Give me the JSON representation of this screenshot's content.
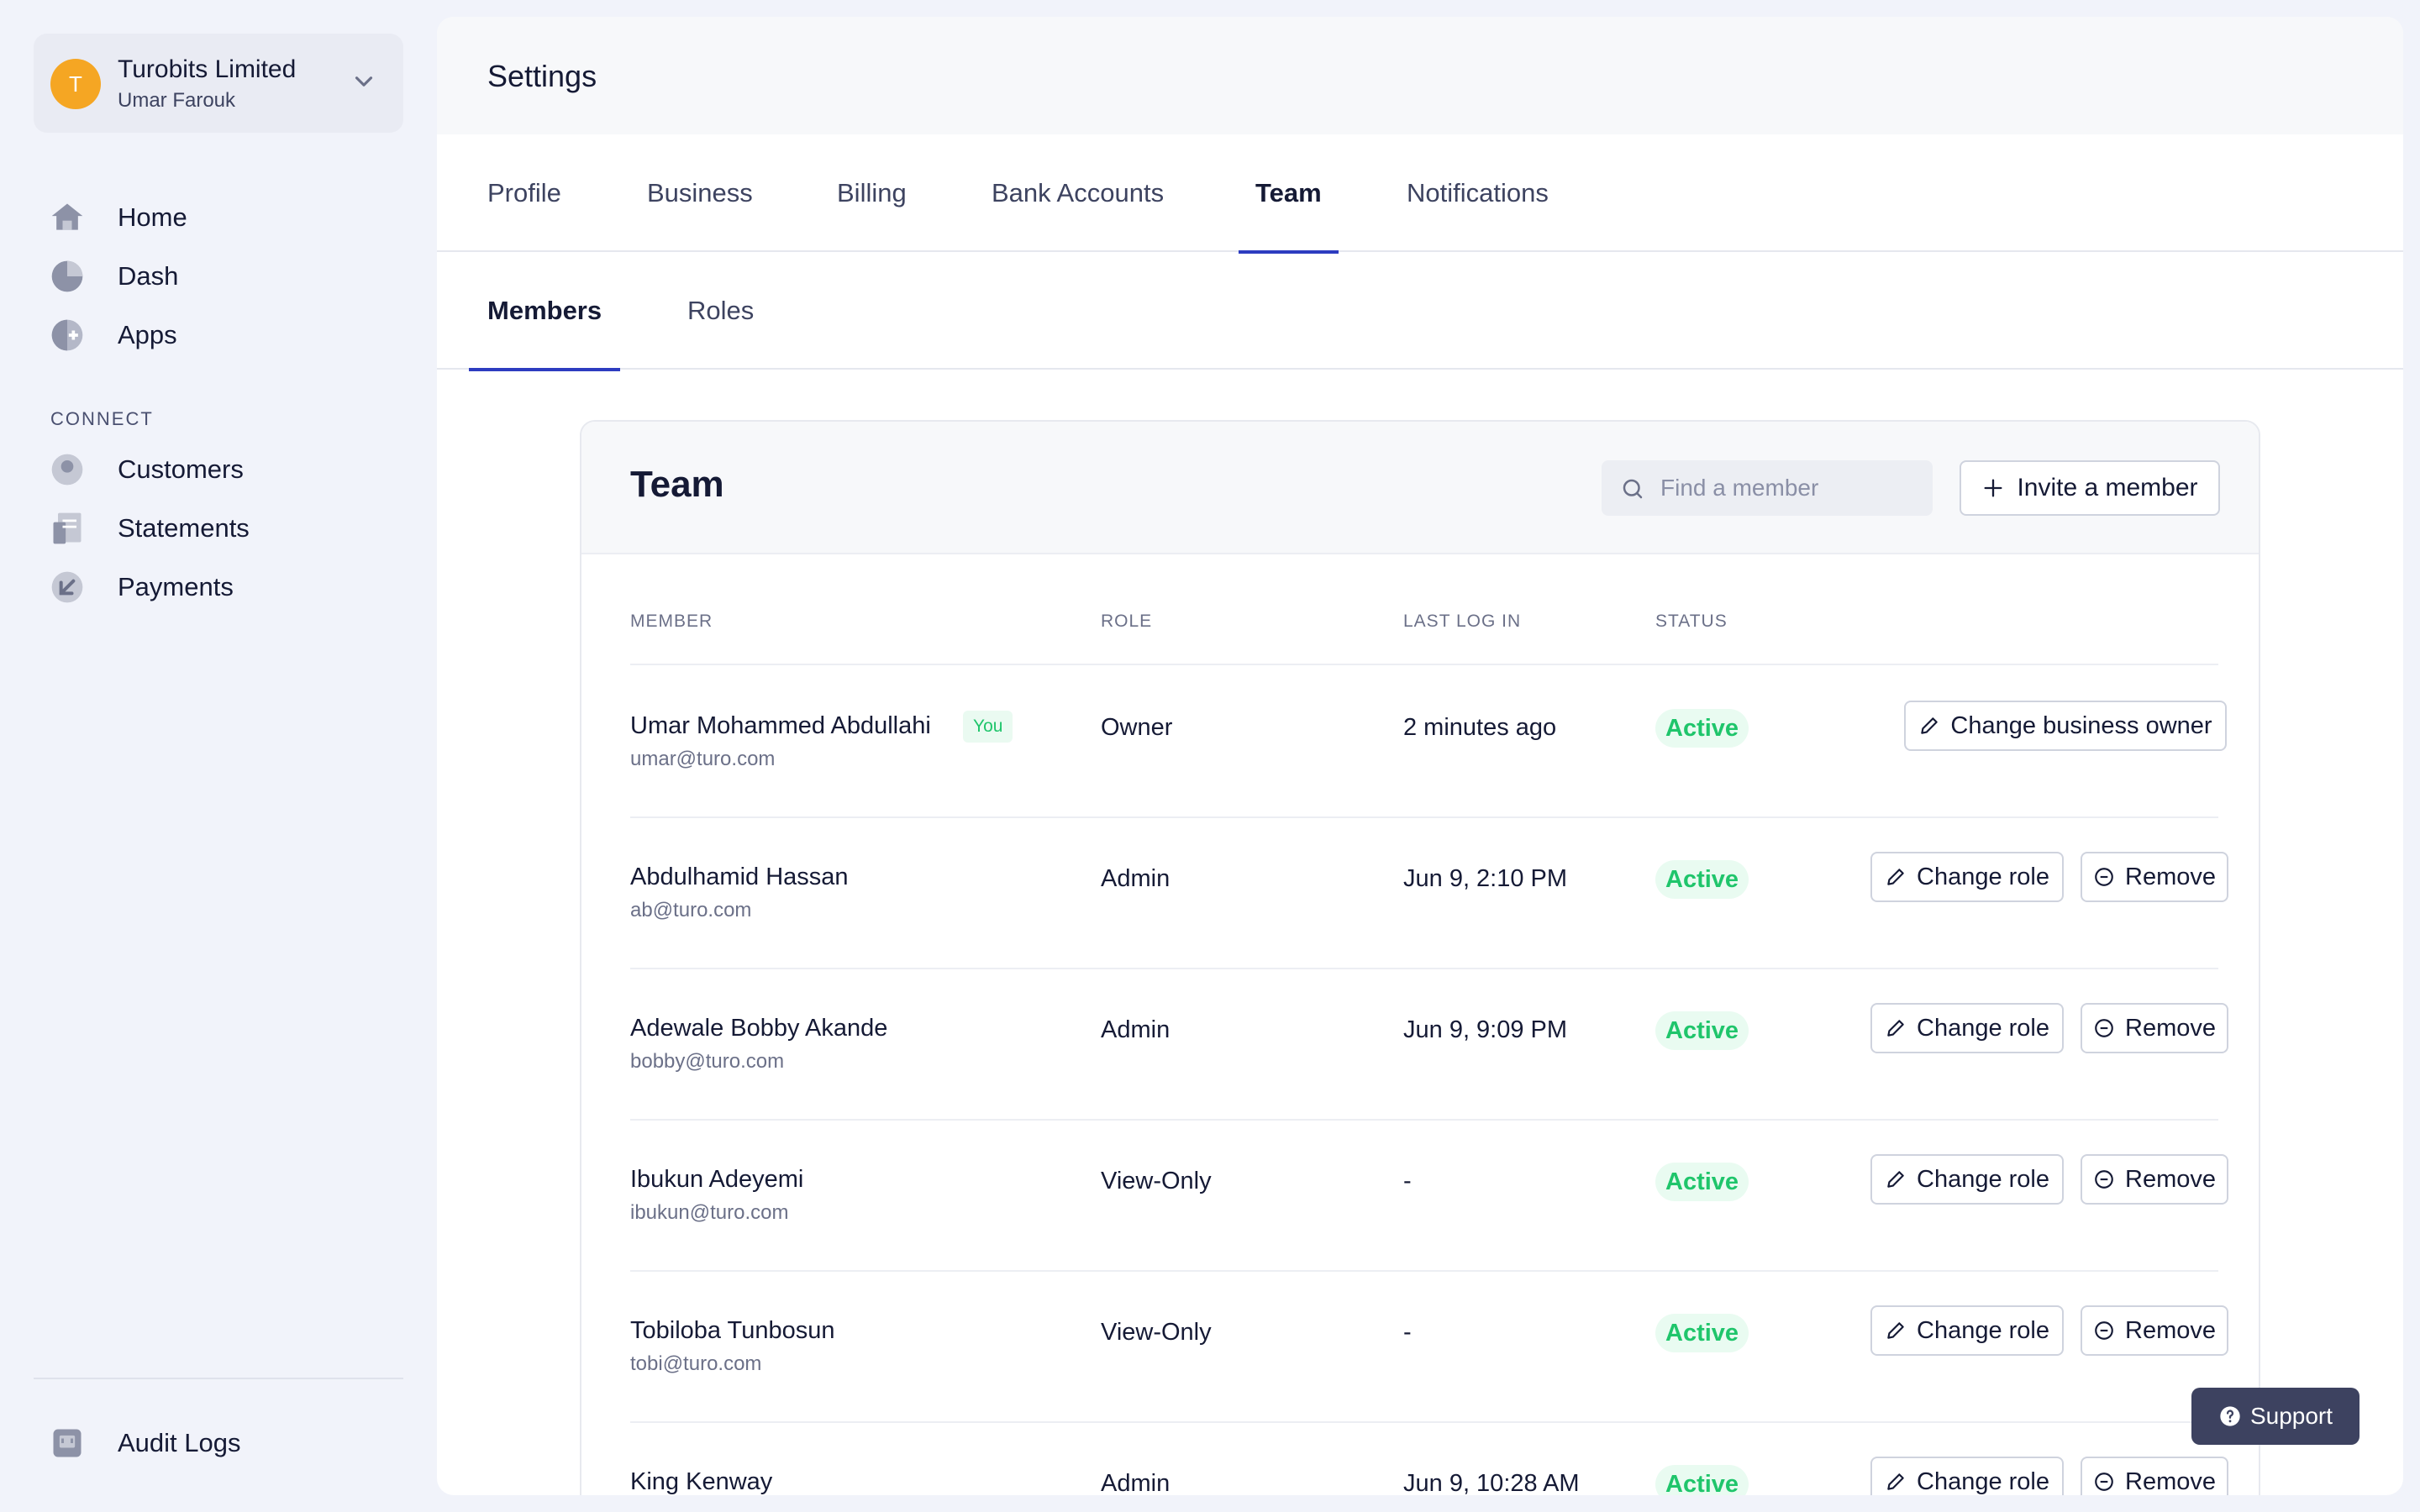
{
  "org": {
    "avatar_letter": "T",
    "name": "Turobits Limited",
    "user": "Umar Farouk"
  },
  "nav": {
    "main": [
      {
        "label": "Home",
        "icon": "home-icon"
      },
      {
        "label": "Dash",
        "icon": "pie-chart-icon"
      },
      {
        "label": "Apps",
        "icon": "apps-icon"
      }
    ],
    "section_title": "CONNECT",
    "connect": [
      {
        "label": "Customers",
        "icon": "user-icon"
      },
      {
        "label": "Statements",
        "icon": "document-icon"
      },
      {
        "label": "Payments",
        "icon": "arrow-down-left-icon"
      }
    ],
    "footer": {
      "label": "Audit Logs",
      "icon": "audit-icon"
    }
  },
  "page": {
    "title": "Settings"
  },
  "tabs": [
    "Profile",
    "Business",
    "Billing",
    "Bank Accounts",
    "Team",
    "Notifications"
  ],
  "active_tab": "Team",
  "subtabs": [
    "Members",
    "Roles"
  ],
  "active_subtab": "Members",
  "team": {
    "title": "Team",
    "search_placeholder": "Find a member",
    "invite_label": "Invite a member",
    "columns": [
      "MEMBER",
      "ROLE",
      "LAST LOG IN",
      "STATUS"
    ],
    "you_label": "You",
    "members": [
      {
        "name": "Umar Mohammed Abdullahi",
        "email": "umar@turo.com",
        "role": "Owner",
        "last_login": "2 minutes ago",
        "status": "Active",
        "is_you": true
      },
      {
        "name": "Abdulhamid Hassan",
        "email": "ab@turo.com",
        "role": "Admin",
        "last_login": "Jun 9, 2:10 PM",
        "status": "Active"
      },
      {
        "name": "Adewale Bobby Akande",
        "email": "bobby@turo.com",
        "role": "Admin",
        "last_login": "Jun 9, 9:09 PM",
        "status": "Active"
      },
      {
        "name": "Ibukun Adeyemi",
        "email": "ibukun@turo.com",
        "role": "View-Only",
        "last_login": "-",
        "status": "Active"
      },
      {
        "name": "Tobiloba Tunbosun",
        "email": "tobi@turo.com",
        "role": "View-Only",
        "last_login": "-",
        "status": "Active"
      },
      {
        "name": "King Kenway",
        "email": "",
        "role": "Admin",
        "last_login": "Jun 9, 10:28 AM",
        "status": "Active"
      }
    ],
    "actions": {
      "change_owner": "Change business owner",
      "change_role": "Change role",
      "remove": "Remove"
    }
  },
  "support_label": "Support",
  "colors": {
    "accent": "#2d3cc0",
    "status_active": "#1fc56b",
    "avatar": "#f5a623",
    "support_bg": "#3d4260"
  }
}
